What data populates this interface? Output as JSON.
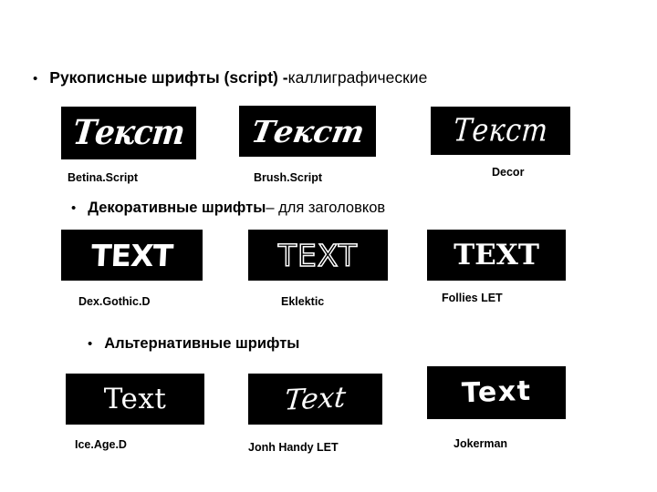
{
  "slide": {
    "background_color": "#ffffff",
    "text_color": "#000000",
    "specimen_background": "#000000",
    "specimen_text_color": "#ffffff"
  },
  "bullets": [
    {
      "mark": "•",
      "bold_part": "Рукописные шрифты (script) -",
      "regular_part": " каллиграфические"
    },
    {
      "mark": "•",
      "bold_part": "Декоративные шрифты",
      "regular_part": " – для заголовков"
    },
    {
      "mark": "•",
      "bold_part": "Альтернативные шрифты",
      "regular_part": ""
    }
  ],
  "rows": [
    {
      "samples": [
        {
          "sample_text": "Текст",
          "font_name": "Betina.Script"
        },
        {
          "sample_text": "Текст",
          "font_name": "Brush.Script"
        },
        {
          "sample_text": "Текст",
          "font_name": "Decor"
        }
      ]
    },
    {
      "samples": [
        {
          "sample_text": "TEXT",
          "font_name": "Dex.Gothic.D"
        },
        {
          "sample_text": "TEXT",
          "font_name": "Eklektic"
        },
        {
          "sample_text": "TEXT",
          "font_name": "Follies LET"
        }
      ]
    },
    {
      "samples": [
        {
          "sample_text": "Text",
          "font_name": "Ice.Age.D"
        },
        {
          "sample_text": "Text",
          "font_name": "Jonh Handy LET"
        },
        {
          "sample_text": "Text",
          "font_name": "Jokerman"
        }
      ]
    }
  ]
}
